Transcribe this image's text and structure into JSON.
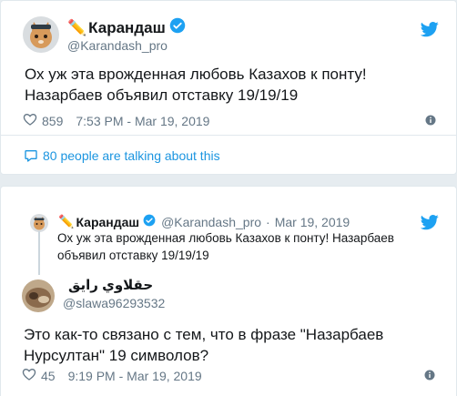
{
  "tweet": {
    "author_name": "Карандаш",
    "author_emoji": "✏️",
    "handle": "@Karandash_pro",
    "text": "Ох уж эта врожденная любовь Казахов к понту! Назарбаев объявил отставку 19/19/19",
    "likes": "859",
    "timestamp": "7:53 PM - Mar 19, 2019",
    "talking": "80 people are talking about this"
  },
  "reply": {
    "quoted": {
      "author_name": "Карандаш",
      "author_emoji": "✏️",
      "handle": "@Karandash_pro",
      "separator": "·",
      "date": "Mar 19, 2019",
      "text": "Ох уж эта врожденная любовь Казахов к понту! Назарбаев объявил отставку 19/19/19"
    },
    "author_name": "حقلاوي رايق",
    "handle": "@slawa96293532",
    "text": "Это как-то связано с тем, что в фразе \"Назарбаев Нурсултан\" 19 символов?",
    "likes": "45",
    "timestamp": "9:19 PM - Mar 19, 2019"
  },
  "icons": {
    "twitter": "twitter-bird-icon",
    "verified": "verified-badge-icon",
    "like": "heart-icon",
    "info": "info-icon",
    "comment": "comment-bubble-icon"
  },
  "colors": {
    "twitter_blue": "#1da1f2",
    "link_blue": "#1b95e0",
    "secondary_text": "#657786",
    "background": "#e6ecf0"
  }
}
